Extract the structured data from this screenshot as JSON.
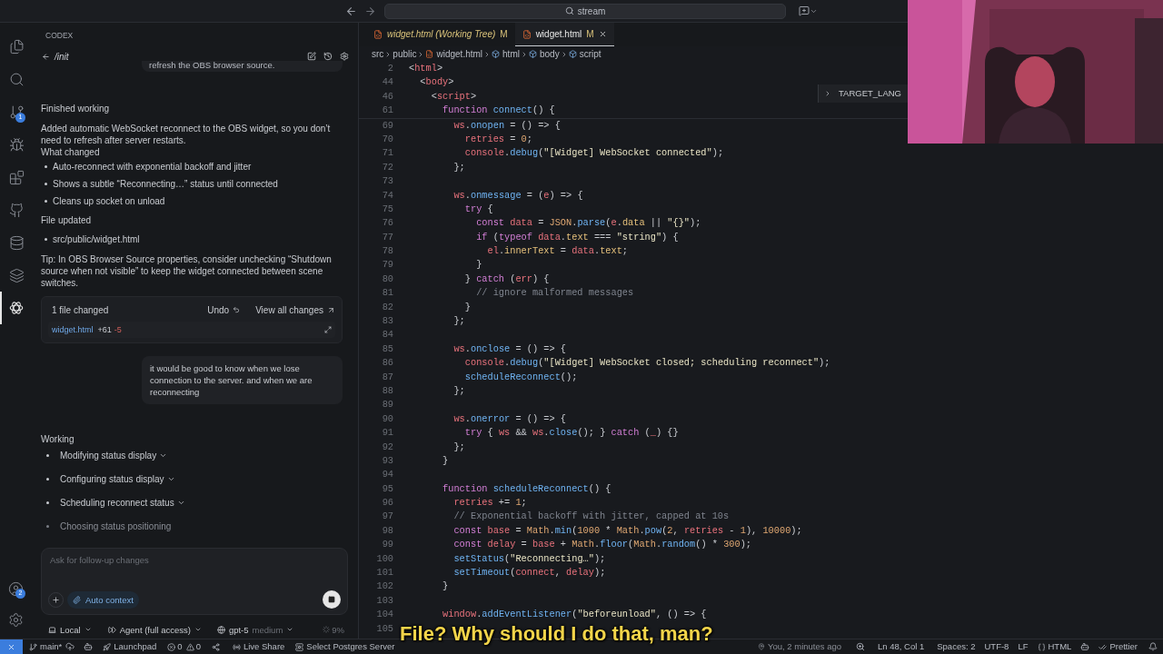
{
  "top_bar": {
    "search": "stream"
  },
  "activity_bar": {
    "items": [
      {
        "kind": "files",
        "selected": false
      },
      {
        "kind": "search",
        "selected": false
      },
      {
        "kind": "git",
        "selected": false,
        "badge": "1"
      },
      {
        "kind": "run",
        "selected": false
      },
      {
        "kind": "extensions",
        "selected": false
      },
      {
        "kind": "github",
        "selected": false
      },
      {
        "kind": "database",
        "selected": false
      },
      {
        "kind": "layers",
        "selected": false
      },
      {
        "kind": "codex",
        "selected": true
      }
    ],
    "bottom_items": [
      {
        "kind": "account",
        "badge": "2"
      },
      {
        "kind": "settings"
      }
    ]
  },
  "codex": {
    "header": "CODEX",
    "thread": "/init",
    "cut_message": "refresh the OBS browser source.",
    "status": "Finished working",
    "summary": "Added automatic WebSocket reconnect to the OBS widget, so you don’t need to refresh after server restarts.",
    "changes_heading": "What changed",
    "changes": [
      "Auto-reconnect with exponential backoff and jitter",
      "Shows a subtle “Reconnecting…” status until connected",
      "Cleans up socket on unload"
    ],
    "files_heading": "File updated",
    "files": [
      "src/public/widget.html"
    ],
    "tip": "Tip: In OBS Browser Source properties, consider unchecking “Shutdown source when not visible” to keep the widget connected between scene switches.",
    "change_card": {
      "count": "1 file changed",
      "undo": "Undo",
      "view_all": "View all changes",
      "file": "widget.html",
      "added": "+61",
      "removed": "-5"
    },
    "user_message": "it would be good to know when we lose connection to the server. and when we are reconnecting",
    "working": {
      "title": "Working",
      "steps": [
        {
          "label": "Modifying status display",
          "in_progress": false
        },
        {
          "label": "Configuring status display",
          "in_progress": false
        },
        {
          "label": "Scheduling reconnect status",
          "in_progress": false
        },
        {
          "label": "Choosing status positioning",
          "in_progress": true
        }
      ]
    },
    "composer": {
      "placeholder": "Ask for follow-up changes",
      "context": "Auto context"
    },
    "footer": {
      "location": "Local",
      "mode": "Agent (full access)",
      "model": "gpt-5",
      "effort": "medium",
      "usage": "9%"
    }
  },
  "editor": {
    "tabs": [
      {
        "label": "widget.html (Working Tree)",
        "badge": "M",
        "italic": true,
        "selected": false
      },
      {
        "label": "widget.html",
        "badge": "M",
        "italic": false,
        "selected": true
      }
    ],
    "breadcrumb": [
      {
        "label": "src",
        "kind": "folder"
      },
      {
        "label": "public",
        "kind": "folder"
      },
      {
        "label": "widget.html",
        "kind": "file"
      },
      {
        "label": "html",
        "kind": "symbol"
      },
      {
        "label": "body",
        "kind": "symbol"
      },
      {
        "label": "script",
        "kind": "symbol"
      }
    ],
    "outline": "TARGET_LANG",
    "sticky_lines": [
      {
        "n": "2",
        "seg": [
          {
            "text": "<",
            "kind": "plain"
          },
          {
            "text": "html",
            "kind": "tag"
          },
          {
            "text": ">",
            "kind": "plain"
          }
        ]
      },
      {
        "n": "44",
        "seg": [
          {
            "text": "  <",
            "kind": "plain"
          },
          {
            "text": "body",
            "kind": "tag"
          },
          {
            "text": ">",
            "kind": "plain"
          }
        ]
      },
      {
        "n": "46",
        "seg": [
          {
            "text": "    <",
            "kind": "plain"
          },
          {
            "text": "script",
            "kind": "tag"
          },
          {
            "text": ">",
            "kind": "plain"
          }
        ]
      },
      {
        "n": "61",
        "seg": [
          {
            "text": "      function ",
            "kind": "keyword"
          },
          {
            "text": "connect",
            "kind": "function"
          },
          {
            "text": "() {",
            "kind": "plain"
          }
        ]
      }
    ],
    "lines": [
      {
        "n": "69",
        "seg": [
          {
            "text": "        ws",
            "kind": "variable"
          },
          {
            "text": ".",
            "kind": "plain"
          },
          {
            "text": "onopen",
            "kind": "function"
          },
          {
            "text": " = () => {",
            "kind": "plain"
          }
        ]
      },
      {
        "n": "70",
        "seg": [
          {
            "text": "          retries",
            "kind": "variable"
          },
          {
            "text": " = ",
            "kind": "plain"
          },
          {
            "text": "0",
            "kind": "number"
          },
          {
            "text": ";",
            "kind": "plain"
          }
        ]
      },
      {
        "n": "71",
        "seg": [
          {
            "text": "          console",
            "kind": "variable"
          },
          {
            "text": ".",
            "kind": "plain"
          },
          {
            "text": "debug",
            "kind": "function"
          },
          {
            "text": "(",
            "kind": "plain"
          },
          {
            "text": "\"[Widget] WebSocket connected\"",
            "kind": "string"
          },
          {
            "text": ");",
            "kind": "plain"
          }
        ]
      },
      {
        "n": "72",
        "seg": [
          {
            "text": "        };",
            "kind": "plain"
          }
        ]
      },
      {
        "n": "73"
      },
      {
        "n": "74",
        "seg": [
          {
            "text": "        ws",
            "kind": "variable"
          },
          {
            "text": ".",
            "kind": "plain"
          },
          {
            "text": "onmessage",
            "kind": "function"
          },
          {
            "text": " = (",
            "kind": "plain"
          },
          {
            "text": "e",
            "kind": "variable"
          },
          {
            "text": ") => {",
            "kind": "plain"
          }
        ]
      },
      {
        "n": "75",
        "seg": [
          {
            "text": "          try",
            "kind": "keyword"
          },
          {
            "text": " {",
            "kind": "plain"
          }
        ]
      },
      {
        "n": "76",
        "seg": [
          {
            "text": "            const ",
            "kind": "keyword"
          },
          {
            "text": "data",
            "kind": "variable"
          },
          {
            "text": " = ",
            "kind": "plain"
          },
          {
            "text": "JSON",
            "kind": "number"
          },
          {
            "text": ".",
            "kind": "plain"
          },
          {
            "text": "parse",
            "kind": "function"
          },
          {
            "text": "(",
            "kind": "plain"
          },
          {
            "text": "e",
            "kind": "variable"
          },
          {
            "text": ".",
            "kind": "plain"
          },
          {
            "text": "data",
            "kind": "property"
          },
          {
            "text": " || ",
            "kind": "plain"
          },
          {
            "text": "\"{}\"",
            "kind": "string"
          },
          {
            "text": ");",
            "kind": "plain"
          }
        ]
      },
      {
        "n": "77",
        "seg": [
          {
            "text": "            if",
            "kind": "keyword"
          },
          {
            "text": " (",
            "kind": "plain"
          },
          {
            "text": "typeof ",
            "kind": "keyword"
          },
          {
            "text": "data",
            "kind": "variable"
          },
          {
            "text": ".",
            "kind": "plain"
          },
          {
            "text": "text",
            "kind": "property"
          },
          {
            "text": " === ",
            "kind": "plain"
          },
          {
            "text": "\"string\"",
            "kind": "string"
          },
          {
            "text": ") {",
            "kind": "plain"
          }
        ]
      },
      {
        "n": "78",
        "seg": [
          {
            "text": "              el",
            "kind": "variable"
          },
          {
            "text": ".",
            "kind": "plain"
          },
          {
            "text": "innerText",
            "kind": "property"
          },
          {
            "text": " = ",
            "kind": "plain"
          },
          {
            "text": "data",
            "kind": "variable"
          },
          {
            "text": ".",
            "kind": "plain"
          },
          {
            "text": "text",
            "kind": "property"
          },
          {
            "text": ";",
            "kind": "plain"
          }
        ]
      },
      {
        "n": "79",
        "seg": [
          {
            "text": "            }",
            "kind": "plain"
          }
        ]
      },
      {
        "n": "80",
        "seg": [
          {
            "text": "          } ",
            "kind": "plain"
          },
          {
            "text": "catch",
            "kind": "keyword"
          },
          {
            "text": " (",
            "kind": "plain"
          },
          {
            "text": "err",
            "kind": "variable"
          },
          {
            "text": ") {",
            "kind": "plain"
          }
        ]
      },
      {
        "n": "81",
        "seg": [
          {
            "text": "            // ignore malformed messages",
            "kind": "comment"
          }
        ]
      },
      {
        "n": "82",
        "seg": [
          {
            "text": "          }",
            "kind": "plain"
          }
        ]
      },
      {
        "n": "83",
        "seg": [
          {
            "text": "        };",
            "kind": "plain"
          }
        ]
      },
      {
        "n": "84"
      },
      {
        "n": "85",
        "seg": [
          {
            "text": "        ws",
            "kind": "variable"
          },
          {
            "text": ".",
            "kind": "plain"
          },
          {
            "text": "onclose",
            "kind": "function"
          },
          {
            "text": " = () => {",
            "kind": "plain"
          }
        ]
      },
      {
        "n": "86",
        "seg": [
          {
            "text": "          console",
            "kind": "variable"
          },
          {
            "text": ".",
            "kind": "plain"
          },
          {
            "text": "debug",
            "kind": "function"
          },
          {
            "text": "(",
            "kind": "plain"
          },
          {
            "text": "\"[Widget] WebSocket closed; scheduling reconnect\"",
            "kind": "string"
          },
          {
            "text": ");",
            "kind": "plain"
          }
        ]
      },
      {
        "n": "87",
        "seg": [
          {
            "text": "          scheduleReconnect",
            "kind": "function"
          },
          {
            "text": "();",
            "kind": "plain"
          }
        ]
      },
      {
        "n": "88",
        "seg": [
          {
            "text": "        };",
            "kind": "plain"
          }
        ]
      },
      {
        "n": "89"
      },
      {
        "n": "90",
        "seg": [
          {
            "text": "        ws",
            "kind": "variable"
          },
          {
            "text": ".",
            "kind": "plain"
          },
          {
            "text": "onerror",
            "kind": "function"
          },
          {
            "text": " = () => {",
            "kind": "plain"
          }
        ]
      },
      {
        "n": "91",
        "seg": [
          {
            "text": "          try",
            "kind": "keyword"
          },
          {
            "text": " { ",
            "kind": "plain"
          },
          {
            "text": "ws",
            "kind": "variable"
          },
          {
            "text": " && ",
            "kind": "plain"
          },
          {
            "text": "ws",
            "kind": "variable"
          },
          {
            "text": ".",
            "kind": "plain"
          },
          {
            "text": "close",
            "kind": "function"
          },
          {
            "text": "(); } ",
            "kind": "plain"
          },
          {
            "text": "catch",
            "kind": "keyword"
          },
          {
            "text": " (",
            "kind": "plain"
          },
          {
            "text": "_",
            "kind": "variable"
          },
          {
            "text": ") {}",
            "kind": "plain"
          }
        ]
      },
      {
        "n": "92",
        "seg": [
          {
            "text": "        };",
            "kind": "plain"
          }
        ]
      },
      {
        "n": "93",
        "seg": [
          {
            "text": "      }",
            "kind": "plain"
          }
        ]
      },
      {
        "n": "94"
      },
      {
        "n": "95",
        "seg": [
          {
            "text": "      function ",
            "kind": "keyword"
          },
          {
            "text": "scheduleReconnect",
            "kind": "function"
          },
          {
            "text": "() {",
            "kind": "plain"
          }
        ]
      },
      {
        "n": "96",
        "seg": [
          {
            "text": "        retries",
            "kind": "variable"
          },
          {
            "text": " += ",
            "kind": "plain"
          },
          {
            "text": "1",
            "kind": "number"
          },
          {
            "text": ";",
            "kind": "plain"
          }
        ]
      },
      {
        "n": "97",
        "seg": [
          {
            "text": "        // Exponential backoff with jitter, capped at 10s",
            "kind": "comment"
          }
        ]
      },
      {
        "n": "98",
        "seg": [
          {
            "text": "        const ",
            "kind": "keyword"
          },
          {
            "text": "base",
            "kind": "variable"
          },
          {
            "text": " = ",
            "kind": "plain"
          },
          {
            "text": "Math",
            "kind": "number"
          },
          {
            "text": ".",
            "kind": "plain"
          },
          {
            "text": "min",
            "kind": "function"
          },
          {
            "text": "(",
            "kind": "plain"
          },
          {
            "text": "1000",
            "kind": "number"
          },
          {
            "text": " * ",
            "kind": "plain"
          },
          {
            "text": "Math",
            "kind": "number"
          },
          {
            "text": ".",
            "kind": "plain"
          },
          {
            "text": "pow",
            "kind": "function"
          },
          {
            "text": "(",
            "kind": "plain"
          },
          {
            "text": "2",
            "kind": "number"
          },
          {
            "text": ", ",
            "kind": "plain"
          },
          {
            "text": "retries",
            "kind": "variable"
          },
          {
            "text": " - ",
            "kind": "plain"
          },
          {
            "text": "1",
            "kind": "number"
          },
          {
            "text": "), ",
            "kind": "plain"
          },
          {
            "text": "10000",
            "kind": "number"
          },
          {
            "text": ");",
            "kind": "plain"
          }
        ]
      },
      {
        "n": "99",
        "seg": [
          {
            "text": "        const ",
            "kind": "keyword"
          },
          {
            "text": "delay",
            "kind": "variable"
          },
          {
            "text": " = ",
            "kind": "plain"
          },
          {
            "text": "base",
            "kind": "variable"
          },
          {
            "text": " + ",
            "kind": "plain"
          },
          {
            "text": "Math",
            "kind": "number"
          },
          {
            "text": ".",
            "kind": "plain"
          },
          {
            "text": "floor",
            "kind": "function"
          },
          {
            "text": "(",
            "kind": "plain"
          },
          {
            "text": "Math",
            "kind": "number"
          },
          {
            "text": ".",
            "kind": "plain"
          },
          {
            "text": "random",
            "kind": "function"
          },
          {
            "text": "() * ",
            "kind": "plain"
          },
          {
            "text": "300",
            "kind": "number"
          },
          {
            "text": ");",
            "kind": "plain"
          }
        ]
      },
      {
        "n": "100",
        "seg": [
          {
            "text": "        setStatus",
            "kind": "function"
          },
          {
            "text": "(",
            "kind": "plain"
          },
          {
            "text": "\"Reconnecting…\"",
            "kind": "string"
          },
          {
            "text": ");",
            "kind": "plain"
          }
        ]
      },
      {
        "n": "101",
        "seg": [
          {
            "text": "        setTimeout",
            "kind": "function"
          },
          {
            "text": "(",
            "kind": "plain"
          },
          {
            "text": "connect",
            "kind": "variable"
          },
          {
            "text": ", ",
            "kind": "plain"
          },
          {
            "text": "delay",
            "kind": "variable"
          },
          {
            "text": ");",
            "kind": "plain"
          }
        ]
      },
      {
        "n": "102",
        "seg": [
          {
            "text": "      }",
            "kind": "plain"
          }
        ]
      },
      {
        "n": "103"
      },
      {
        "n": "104",
        "seg": [
          {
            "text": "      window",
            "kind": "variable"
          },
          {
            "text": ".",
            "kind": "plain"
          },
          {
            "text": "addEventListener",
            "kind": "function"
          },
          {
            "text": "(",
            "kind": "plain"
          },
          {
            "text": "\"beforeunload\"",
            "kind": "string"
          },
          {
            "text": ", () => {",
            "kind": "plain"
          }
        ]
      },
      {
        "n": "105"
      }
    ]
  },
  "caption": "File? Why should I do that, man?",
  "status_bar": {
    "branch": "main*",
    "launchpad": "Launchpad",
    "errors": "0",
    "warnings": "0",
    "live_share": "Live Share",
    "postgres": "Select Postgres Server",
    "blame": "You, 2 minutes ago",
    "position": "Ln 48, Col 1",
    "spaces": "Spaces: 2",
    "encoding": "UTF-8",
    "eol": "LF",
    "language": "HTML",
    "formatter": "Prettier"
  }
}
